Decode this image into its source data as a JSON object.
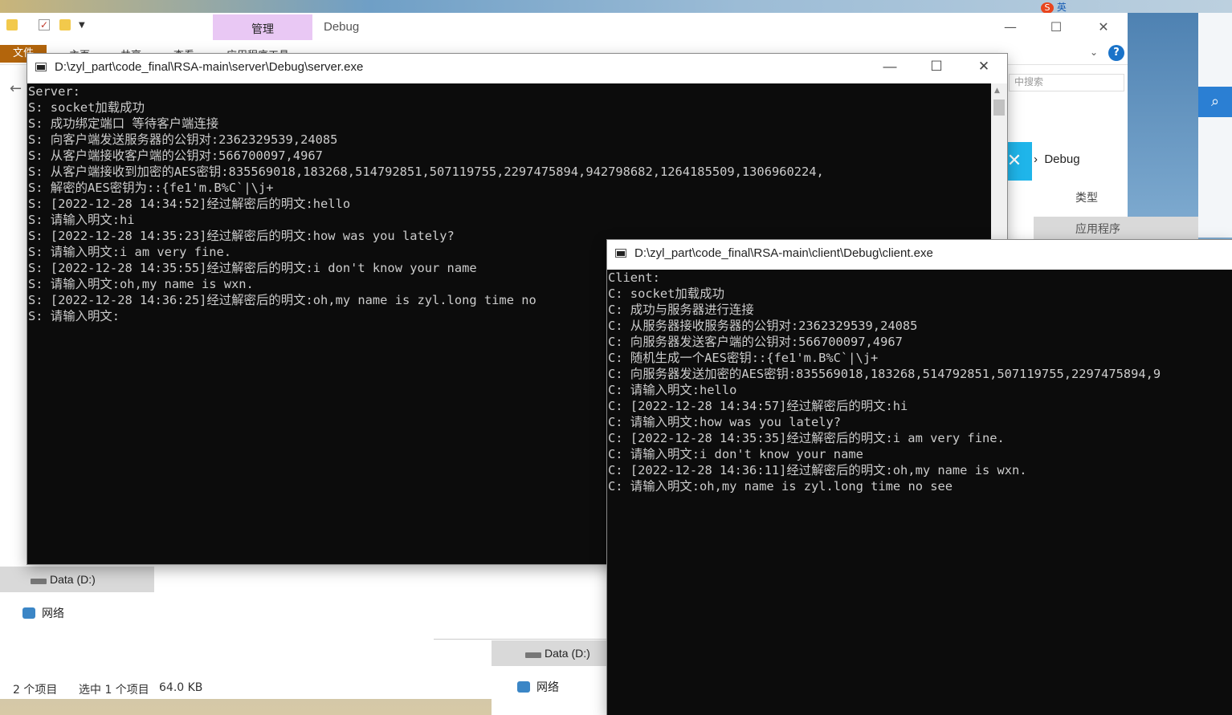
{
  "explorer": {
    "manage_tab": "管理",
    "title": "Debug",
    "file_tab": "文件",
    "ribbon_tabs": [
      "主页",
      "共享",
      "查看",
      "应用程序工具"
    ],
    "search_placeholder": "中搜索",
    "breadcrumb": "Debug",
    "column_type": "类型",
    "file_type": "应用程序",
    "drive_label": "Data (D:)",
    "network_label": "网络",
    "status_items": "2 个项目",
    "status_selected": "选中 1 个项目",
    "status_size": "64.0 KB"
  },
  "server_window": {
    "title": "D:\\zyl_part\\code_final\\RSA-main\\server\\Debug\\server.exe",
    "lines": [
      "Server:",
      "S: socket加载成功",
      "S: 成功绑定端口 等待客户端连接",
      "S: 向客户端发送服务器的公钥对:2362329539,24085",
      "S: 从客户端接收客户端的公钥对:566700097,4967",
      "S: 从客户端接收到加密的AES密钥:835569018,183268,514792851,507119755,2297475894,942798682,1264185509,1306960224,",
      "S: 解密的AES密钥为::{fe1'm.B%C`|\\j+",
      "S: [2022-12-28 14:34:52]经过解密后的明文:hello",
      "S: 请输入明文:hi",
      "S: [2022-12-28 14:35:23]经过解密后的明文:how was you lately?",
      "S: 请输入明文:i am very fine.",
      "S: [2022-12-28 14:35:55]经过解密后的明文:i don't know your name",
      "S: 请输入明文:oh,my name is wxn.",
      "S: [2022-12-28 14:36:25]经过解密后的明文:oh,my name is zyl.long time no",
      "S: 请输入明文:"
    ]
  },
  "client_window": {
    "title": "D:\\zyl_part\\code_final\\RSA-main\\client\\Debug\\client.exe",
    "lines": [
      "Client:",
      "C: socket加载成功",
      "C: 成功与服务器进行连接",
      "C: 从服务器接收服务器的公钥对:2362329539,24085",
      "C: 向服务器发送客户端的公钥对:566700097,4967",
      "C: 随机生成一个AES密钥::{fe1'm.B%C`|\\j+",
      "C: 向服务器发送加密的AES密钥:835569018,183268,514792851,507119755,2297475894,9",
      "C: 请输入明文:hello",
      "C: [2022-12-28 14:34:57]经过解密后的明文:hi",
      "C: 请输入明文:how was you lately?",
      "C: [2022-12-28 14:35:35]经过解密后的明文:i am very fine.",
      "C: 请输入明文:i don't know your name",
      "C: [2022-12-28 14:36:11]经过解密后的明文:oh,my name is wxn.",
      "C: 请输入明文:oh,my name is zyl.long time no see"
    ]
  },
  "controls": {
    "minimize": "—",
    "maximize": "☐",
    "close": "✕"
  },
  "taskbar": {
    "ime_label": "英"
  },
  "colors": {
    "console_bg": "#0c0c0c",
    "console_text": "#cccccc",
    "manage_tab": "#e9c8f4",
    "file_tab": "#b3650c"
  }
}
